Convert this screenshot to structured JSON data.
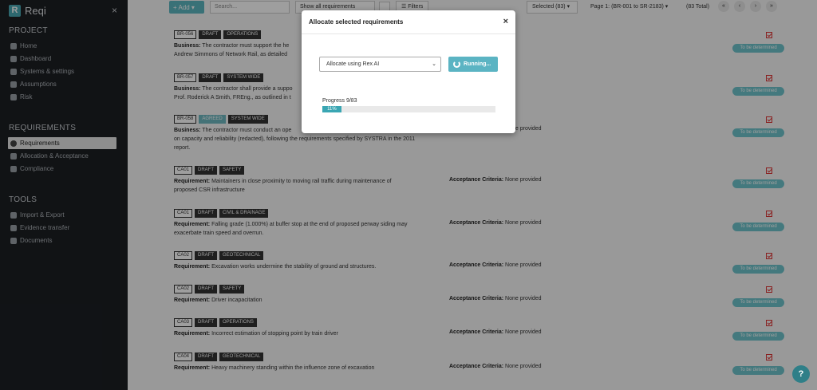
{
  "sidebar": {
    "brand": "Reqi",
    "brand_letter": "R",
    "close": "×",
    "sections": [
      {
        "title": "PROJECT",
        "items": [
          "Home",
          "Dashboard",
          "Systems & settings",
          "Assumptions",
          "Risk"
        ]
      },
      {
        "title": "REQUIREMENTS",
        "items": [
          "Requirements",
          "Allocation & Acceptance",
          "Compliance"
        ]
      },
      {
        "title": "TOOLS",
        "items": [
          "Import & Export",
          "Evidence transfer",
          "Documents"
        ]
      }
    ],
    "active_item": "Requirements"
  },
  "toolbar": {
    "add": "+ Add ▾",
    "search_placeholder": "Search...",
    "show_select": "Show all requirements",
    "filters": "☰ Filters",
    "selected": "Selected (83) ▾",
    "page": "Page 1: (BR-001 to SR-2183) ▾",
    "total": "(83 Total)",
    "pager": [
      "«",
      "‹",
      "›",
      "»"
    ]
  },
  "requirements": [
    {
      "id": "BR-056",
      "status": "DRAFT",
      "category": "OPERATIONS",
      "type": "Business:",
      "lines": [
        "The contractor must support the he",
        "Andrew Simmons of Network Rail, as detailed"
      ],
      "accept_label": "",
      "accept_value": "None provided"
    },
    {
      "id": "BR-057",
      "status": "DRAFT",
      "category": "SYSTEM WIDE",
      "type": "Business:",
      "lines": [
        "The contractor shall provide a suppo",
        "Prof. Roderick A Smith, FREng., as outlined in t"
      ],
      "accept_label": "",
      "accept_value": "None provided"
    },
    {
      "id": "BR-058",
      "status": "AGREED",
      "category": "SYSTEM WIDE",
      "type": "Business:",
      "lines": [
        "The contractor must conduct an ope",
        "on capacity and reliability (redacted), following the requirements specified by SYSTRA in the 2011",
        "report."
      ],
      "accept_label": "Acceptance Criteria:",
      "accept_value": "None provided"
    },
    {
      "id": "CA01",
      "status": "DRAFT",
      "category": "SAFETY",
      "type": "Requirement:",
      "lines": [
        "Maintainers in close proximity to moving rail traffic during maintenance of",
        "proposed CSR infrastructure"
      ],
      "accept_label": "Acceptance Criteria:",
      "accept_value": "None provided"
    },
    {
      "id": "CA01",
      "status": "DRAFT",
      "category": "CIVIL & DRAINAGE",
      "type": "Requirement:",
      "lines": [
        "Falling grade (1.000%) at buffer stop at the end of proposed perway siding may",
        "exacerbate train speed and overrun."
      ],
      "accept_label": "Acceptance Criteria:",
      "accept_value": "None provided"
    },
    {
      "id": "CA02",
      "status": "DRAFT",
      "category": "GEOTECHNICAL",
      "type": "Requirement:",
      "lines": [
        "Excavation works undermine the stability of ground and structures."
      ],
      "accept_label": "Acceptance Criteria:",
      "accept_value": "None provided"
    },
    {
      "id": "CA02",
      "status": "DRAFT",
      "category": "SAFETY",
      "type": "Requirement:",
      "lines": [
        "Driver incapacitation"
      ],
      "accept_label": "Acceptance Criteria:",
      "accept_value": "None provided"
    },
    {
      "id": "CA03",
      "status": "DRAFT",
      "category": "OPERATIONS",
      "type": "Requirement:",
      "lines": [
        "Incorrect estimation of stopping point by train driver"
      ],
      "accept_label": "Acceptance Criteria:",
      "accept_value": "None provided"
    },
    {
      "id": "CA04",
      "status": "DRAFT",
      "category": "GEOTECHNICAL",
      "type": "Requirement:",
      "lines": [
        "Heavy machinery standing within the influence zone of excavation"
      ],
      "accept_label": "Acceptance Criteria:",
      "accept_value": "None provided"
    }
  ],
  "badge": "To be determined",
  "help": "?",
  "modal": {
    "title": "Allocate selected requirements",
    "close": "×",
    "select_value": "Allocate using Rex AI",
    "run_label": "Running...",
    "progress_label": "Progress 9/83",
    "progress_fraction": 0.11,
    "progress_text": "11%"
  }
}
